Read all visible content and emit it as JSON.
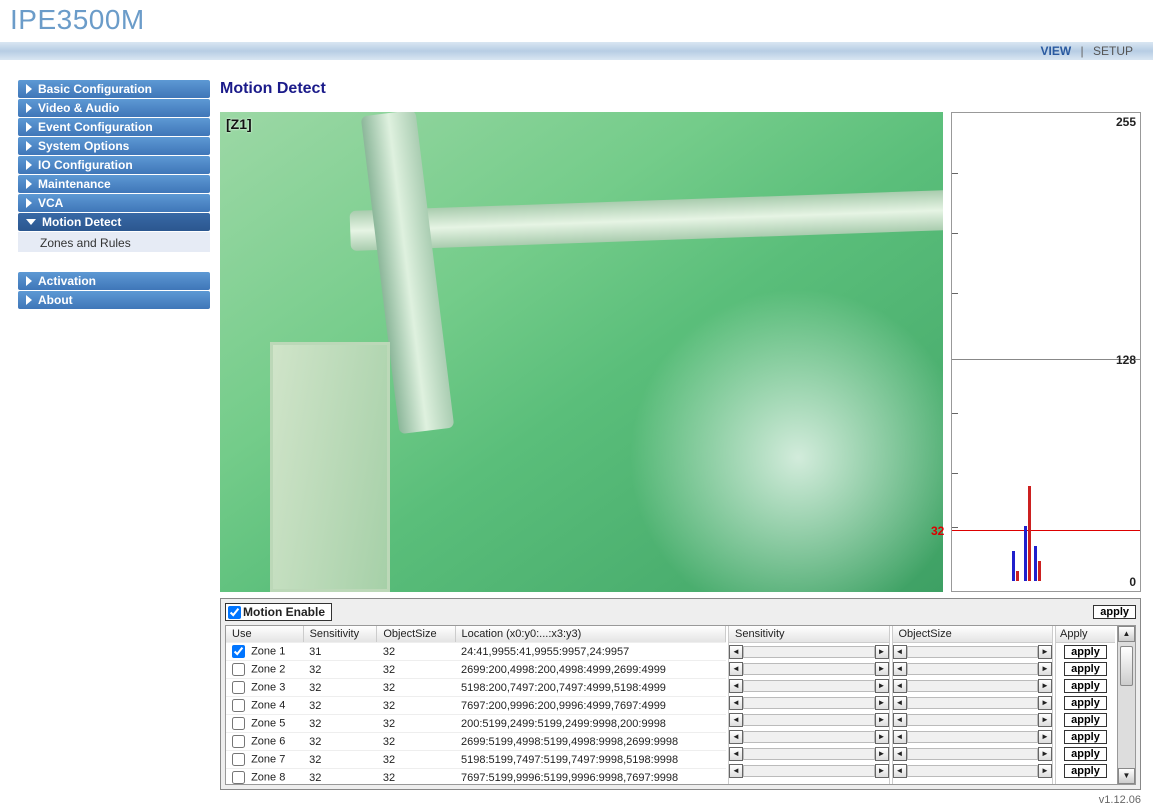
{
  "product_title": "IPE3500M",
  "top_nav": {
    "view": "VIEW",
    "setup": "SETUP",
    "sep": "|"
  },
  "sidebar": {
    "group1": [
      {
        "label": "Basic Configuration"
      },
      {
        "label": "Video & Audio"
      },
      {
        "label": "Event Configuration"
      },
      {
        "label": "System Options"
      },
      {
        "label": "IO Configuration"
      },
      {
        "label": "Maintenance"
      },
      {
        "label": "VCA"
      },
      {
        "label": "Motion Detect",
        "active": true
      }
    ],
    "sub_item": "Zones and Rules",
    "group2": [
      {
        "label": "Activation"
      },
      {
        "label": "About"
      }
    ]
  },
  "section_title": "Motion Detect",
  "video": {
    "zone_label": "[Z1]"
  },
  "histogram": {
    "max": "255",
    "mid": "128",
    "threshold": "32",
    "zero": "0"
  },
  "controls": {
    "motion_enable_label": "Motion Enable",
    "motion_enable_checked": true,
    "top_apply_label": "apply"
  },
  "table": {
    "headers": {
      "use": "Use",
      "sensitivity": "Sensitivity",
      "object": "ObjectSize",
      "location": "Location (x0:y0:...:x3:y3)"
    },
    "slider_headers": {
      "sens": "Sensitivity",
      "obj": "ObjectSize",
      "apply": "Apply"
    },
    "apply_label": "apply",
    "rows": [
      {
        "checked": true,
        "name": "Zone 1",
        "sens": "31",
        "obj": "32",
        "loc": "24:41,9955:41,9955:9957,24:9957"
      },
      {
        "checked": false,
        "name": "Zone 2",
        "sens": "32",
        "obj": "32",
        "loc": "2699:200,4998:200,4998:4999,2699:4999"
      },
      {
        "checked": false,
        "name": "Zone 3",
        "sens": "32",
        "obj": "32",
        "loc": "5198:200,7497:200,7497:4999,5198:4999"
      },
      {
        "checked": false,
        "name": "Zone 4",
        "sens": "32",
        "obj": "32",
        "loc": "7697:200,9996:200,9996:4999,7697:4999"
      },
      {
        "checked": false,
        "name": "Zone 5",
        "sens": "32",
        "obj": "32",
        "loc": "200:5199,2499:5199,2499:9998,200:9998"
      },
      {
        "checked": false,
        "name": "Zone 6",
        "sens": "32",
        "obj": "32",
        "loc": "2699:5199,4998:5199,4998:9998,2699:9998"
      },
      {
        "checked": false,
        "name": "Zone 7",
        "sens": "32",
        "obj": "32",
        "loc": "5198:5199,7497:5199,7497:9998,5198:9998"
      },
      {
        "checked": false,
        "name": "Zone 8",
        "sens": "32",
        "obj": "32",
        "loc": "7697:5199,9996:5199,9996:9998,7697:9998"
      }
    ]
  },
  "footer_version": "v1.12.06"
}
